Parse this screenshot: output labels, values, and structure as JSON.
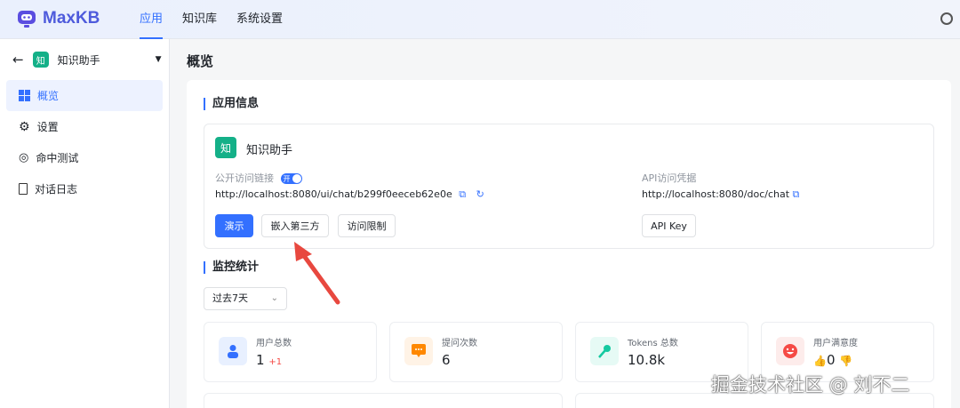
{
  "header": {
    "brand": "MaxKB",
    "nav": [
      {
        "label": "应用"
      },
      {
        "label": "知识库"
      },
      {
        "label": "系统设置"
      }
    ]
  },
  "sidebar": {
    "app_avatar": "知",
    "app_name": "知识助手",
    "items": [
      {
        "label": "概览",
        "icon": "grid-icon"
      },
      {
        "label": "设置",
        "icon": "gear-icon"
      },
      {
        "label": "命中测试",
        "icon": "target-icon"
      },
      {
        "label": "对话日志",
        "icon": "document-icon"
      }
    ]
  },
  "page": {
    "title": "概览"
  },
  "app_info": {
    "section_title": "应用信息",
    "avatar": "知",
    "name": "知识助手",
    "public_link_label": "公开访问链接",
    "toggle_label": "开",
    "public_url": "http://localhost:8080/ui/chat/b299f0eeceb62e0e",
    "api_label": "API访问凭据",
    "api_url": "http://localhost:8080/doc/chat",
    "buttons": {
      "demo": "演示",
      "embed": "嵌入第三方",
      "access": "访问限制",
      "api_key": "API Key"
    }
  },
  "monitor": {
    "section_title": "监控统计",
    "range": "过去7天",
    "stats": [
      {
        "label": "用户总数",
        "value": "1",
        "delta": "+1"
      },
      {
        "label": "提问次数",
        "value": "6"
      },
      {
        "label": "Tokens 总数",
        "value": "10.8k"
      },
      {
        "label": "用户满意度",
        "like": "0"
      }
    ]
  },
  "watermark": "掘金技术社区 @ 刘不二",
  "colors": {
    "accent": "#3370ff",
    "annotation": "#e8483f"
  }
}
